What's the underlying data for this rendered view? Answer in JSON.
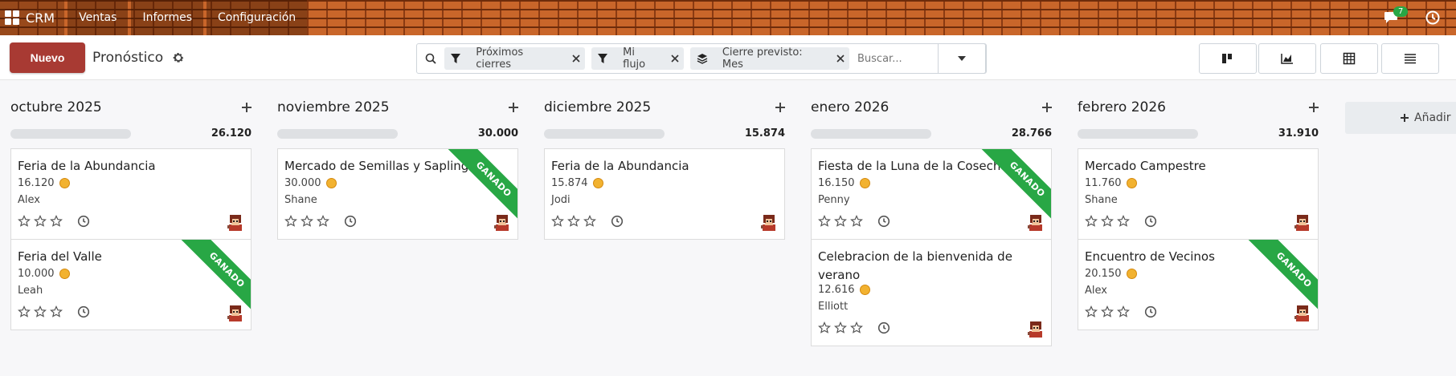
{
  "navbar": {
    "app_name": "CRM",
    "menus": [
      "Ventas",
      "Informes",
      "Configuración"
    ],
    "chat_count": "7"
  },
  "control": {
    "new_label": "Nuevo",
    "title": "Pronóstico",
    "facets": [
      "Próximos cierres",
      "Mi flujo",
      "Cierre previsto: Mes"
    ],
    "search_placeholder": "Buscar..."
  },
  "add_column_label": "Añadir",
  "columns": [
    {
      "title": "octubre 2025",
      "total": "26.120",
      "cards": [
        {
          "name": "Feria de la Abundancia",
          "amount": "16.120",
          "user": "Alex",
          "won": false
        },
        {
          "name": "Feria del Valle",
          "amount": "10.000",
          "user": "Leah",
          "won": true
        }
      ]
    },
    {
      "title": "noviembre 2025",
      "total": "30.000",
      "cards": [
        {
          "name": "Mercado de Semillas y Saplings",
          "amount": "30.000",
          "user": "Shane",
          "won": true
        }
      ]
    },
    {
      "title": "diciembre 2025",
      "total": "15.874",
      "cards": [
        {
          "name": "Feria de la Abundancia",
          "amount": "15.874",
          "user": "Jodi",
          "won": false
        }
      ]
    },
    {
      "title": "enero 2026",
      "total": "28.766",
      "cards": [
        {
          "name": "Fiesta de la Luna de la Cosecha",
          "amount": "16.150",
          "user": "Penny",
          "won": true
        },
        {
          "name": "Celebracion de la bienvenida de verano",
          "amount": "12.616",
          "user": "Elliott",
          "won": false
        }
      ]
    },
    {
      "title": "febrero 2026",
      "total": "31.910",
      "cards": [
        {
          "name": "Mercado Campestre",
          "amount": "11.760",
          "user": "Shane",
          "won": false
        },
        {
          "name": "Encuentro de Vecinos",
          "amount": "20.150",
          "user": "Alex",
          "won": true
        }
      ]
    }
  ],
  "ribbon_label": "GANADO",
  "colors": {
    "primary": "#a83a33",
    "won": "#28a745",
    "navbar": "#b8531e"
  },
  "icons": [
    "apps-icon",
    "chat-icon",
    "clock-icon",
    "gear-icon",
    "search-icon",
    "filter-icon",
    "layers-icon",
    "close-icon",
    "caret-down-icon",
    "kanban-view-icon",
    "graph-view-icon",
    "pivot-view-icon",
    "list-view-icon",
    "plus-icon",
    "star-icon",
    "coin-icon",
    "avatar"
  ]
}
